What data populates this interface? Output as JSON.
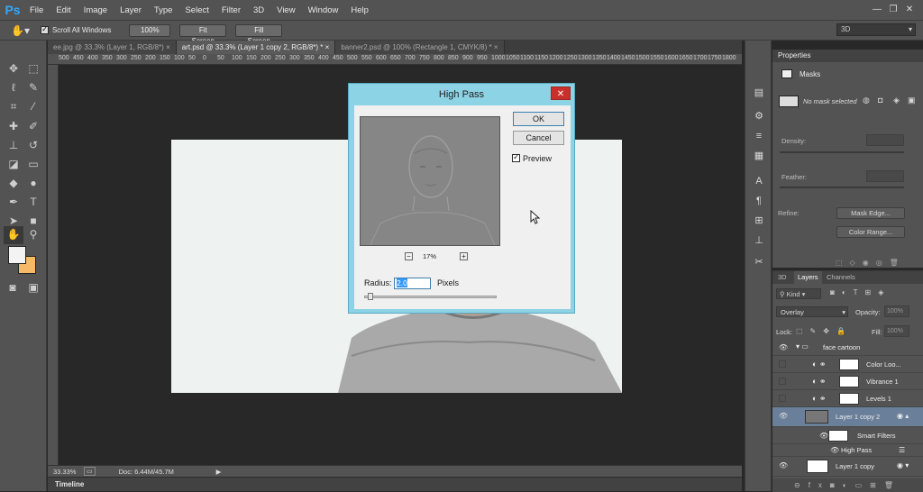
{
  "menubar": {
    "logo": "Ps",
    "items": [
      "File",
      "Edit",
      "Image",
      "Layer",
      "Type",
      "Select",
      "Filter",
      "3D",
      "View",
      "Window",
      "Help"
    ],
    "window_controls": [
      "—",
      "❐",
      "✕"
    ]
  },
  "options": {
    "scroll_all_label": "Scroll All Windows",
    "scroll_all_checked": true,
    "btn_100": "100%",
    "btn_fit": "Fit Screen",
    "btn_fill": "Fill Screen",
    "workspace": "3D"
  },
  "tabs": [
    {
      "label": "ee.jpg @ 33.3% (Layer 1, RGB/8*)",
      "active": false
    },
    {
      "label": "art.psd @ 33.3% (Layer 1 copy 2, RGB/8*) *",
      "active": true
    },
    {
      "label": "banner2.psd @ 100% (Rectangle 1, CMYK/8) *",
      "active": false
    }
  ],
  "ruler_ticks": [
    "500",
    "450",
    "400",
    "350",
    "300",
    "250",
    "200",
    "150",
    "100",
    "50",
    "0",
    "50",
    "100",
    "150",
    "200",
    "250",
    "300",
    "350",
    "400",
    "450",
    "500",
    "550",
    "600",
    "650",
    "700",
    "750",
    "800",
    "850",
    "900",
    "950",
    "1000",
    "1050",
    "1100",
    "1150",
    "1200",
    "1250",
    "1300",
    "1350",
    "1400",
    "1450",
    "1500",
    "1550",
    "1600",
    "1650",
    "1700",
    "1750",
    "1800",
    "1850",
    "1900",
    "1950",
    "2000",
    "2050",
    "2100",
    "2150",
    "2200",
    "2250",
    "2300",
    "2350",
    "2400",
    "2450",
    "2500",
    "2550",
    "2600",
    "2650",
    "2700",
    "2750",
    "2800",
    "2850"
  ],
  "status": {
    "zoom": "33.33%",
    "doc": "Doc: 6.44M/45.7M"
  },
  "timeline": "Timeline",
  "properties": {
    "tab": "Properties",
    "title": "Masks",
    "no_mask": "No mask selected",
    "density_label": "Density:",
    "feather_label": "Feather:",
    "refine_label": "Refine:",
    "mask_edge_btn": "Mask Edge...",
    "color_range_btn": "Color Range..."
  },
  "layers": {
    "tabs": [
      "3D",
      "Layers",
      "Channels"
    ],
    "kind_label": "Kind",
    "blend_mode": "Overlay",
    "opacity_label": "Opacity:",
    "opacity_value": "100%",
    "lock_label": "Lock:",
    "fill_label": "Fill:",
    "fill_value": "100%",
    "rows": [
      {
        "name": "face cartoon",
        "kind": "group",
        "visible": true
      },
      {
        "name": "Color Loo...",
        "kind": "adjust",
        "visible": false
      },
      {
        "name": "Vibrance 1",
        "kind": "adjust",
        "visible": false
      },
      {
        "name": "Levels 1",
        "kind": "adjust",
        "visible": false
      },
      {
        "name": "Layer 1 copy 2",
        "kind": "smart",
        "visible": true,
        "selected": true
      },
      {
        "name": "Smart Filters",
        "kind": "filters",
        "visible": true
      },
      {
        "name": "High Pass",
        "kind": "filter",
        "visible": true
      },
      {
        "name": "Layer 1 copy",
        "kind": "smart",
        "visible": true
      }
    ]
  },
  "dialog": {
    "title": "High Pass",
    "ok": "OK",
    "cancel": "Cancel",
    "preview_label": "Preview",
    "preview_checked": true,
    "zoom": "17%",
    "zoom_out": "−",
    "zoom_in": "+",
    "radius_label": "Radius:",
    "radius_value": "2.0",
    "units": "Pixels"
  }
}
